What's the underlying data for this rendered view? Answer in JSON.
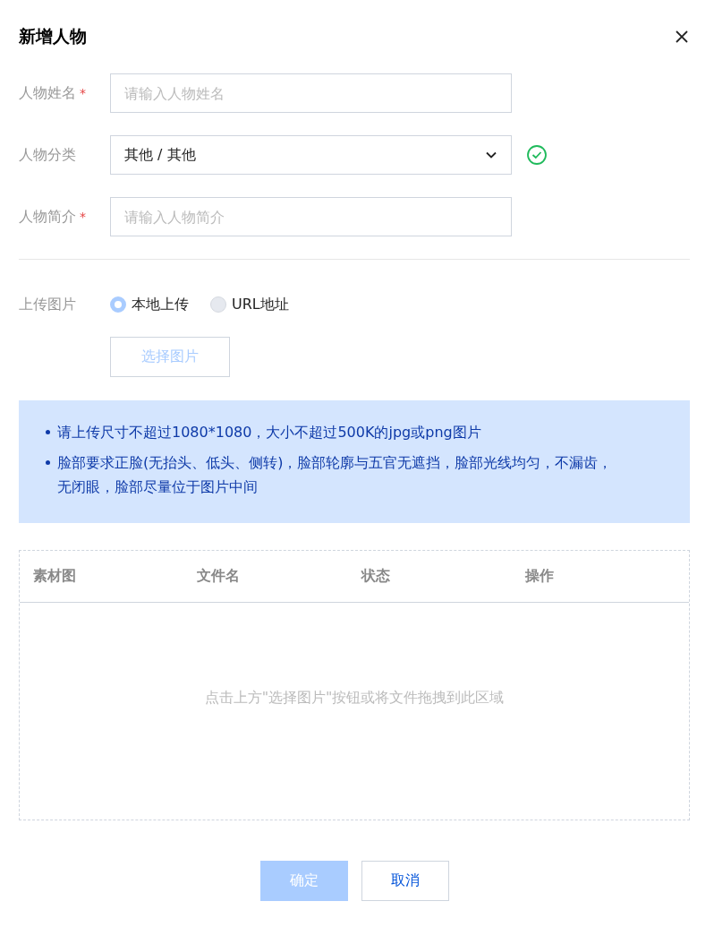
{
  "dialog": {
    "title": "新增人物"
  },
  "fields": [
    {
      "kind": "input",
      "label": "人物姓名",
      "required_mark": "*",
      "placeholder": "请输入人物姓名"
    },
    {
      "kind": "select",
      "label": "人物分类",
      "value": "其他 / 其他",
      "valid": true
    },
    {
      "kind": "input",
      "label": "人物简介",
      "required_mark": "*",
      "placeholder": "请输入人物简介"
    }
  ],
  "upload": {
    "label": "上传图片",
    "options": [
      {
        "label": "本地上传",
        "selected": true
      },
      {
        "label": "URL地址",
        "selected": false
      }
    ],
    "button": {
      "label": "选择图片",
      "disabled": true
    }
  },
  "notice": [
    "请上传尺寸不超过1080*1080，大小不超过500K的jpg或png图片",
    "脸部要求正脸(无抬头、低头、侧转)，脸部轮廓与五官无遮挡，脸部光线均匀，不漏齿，无闭眼，脸部尽量位于图片中间"
  ],
  "table": {
    "columns": [
      "素材图",
      "文件名",
      "状态",
      "操作"
    ],
    "empty_text": "点击上方\"选择图片\"按钮或将文件拖拽到此区域"
  },
  "footer": [
    {
      "label": "确定",
      "kind": "primary",
      "disabled": true
    },
    {
      "label": "取消",
      "kind": "default",
      "disabled": false
    }
  ]
}
